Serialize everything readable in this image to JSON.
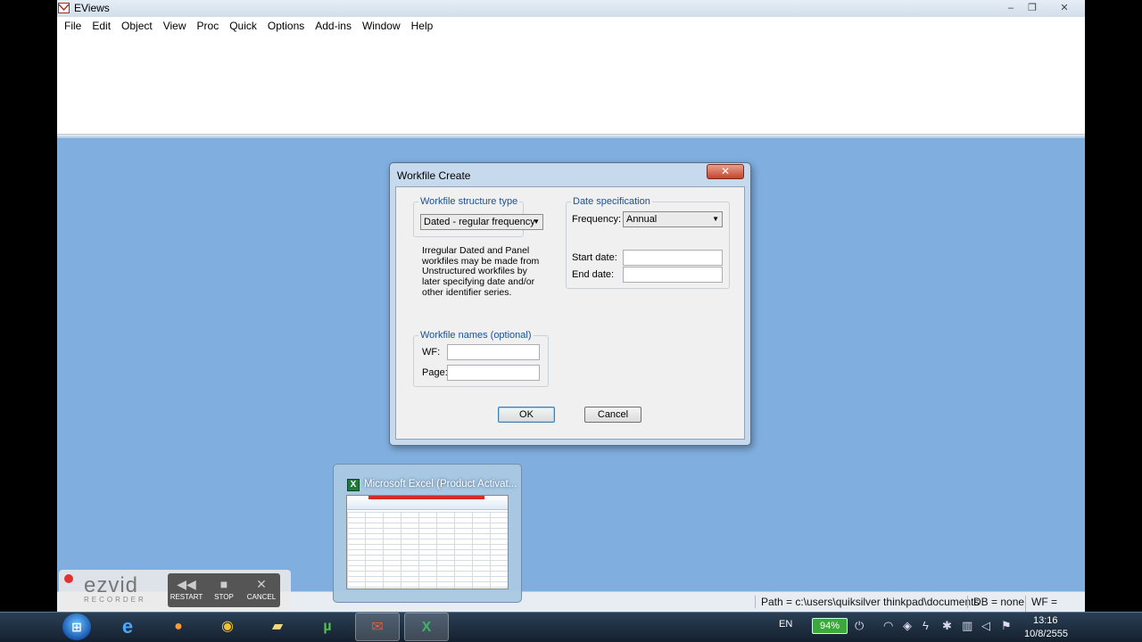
{
  "app": {
    "title": "EViews",
    "menu": [
      "File",
      "Edit",
      "Object",
      "View",
      "Proc",
      "Quick",
      "Options",
      "Add-ins",
      "Window",
      "Help"
    ],
    "status": {
      "path": "Path = c:\\users\\quiksilver thinkpad\\documents",
      "db": "DB = none",
      "wf": "WF = none"
    }
  },
  "dialog": {
    "title": "Workfile Create",
    "close_glyph": "✕",
    "structure": {
      "legend": "Workfile structure type",
      "selected": "Dated - regular frequency",
      "info": "Irregular Dated and Panel workfiles may be made from Unstructured workfiles by later specifying date and/or other identifier series."
    },
    "date_spec": {
      "legend": "Date specification",
      "frequency_label": "Frequency:",
      "frequency_value": "Annual",
      "start_label": "Start date:",
      "start_value": "",
      "end_label": "End date:",
      "end_value": ""
    },
    "names": {
      "legend": "Workfile names (optional)",
      "wf_label": "WF:",
      "wf_value": "",
      "page_label": "Page:",
      "page_value": ""
    },
    "ok_label": "OK",
    "cancel_label": "Cancel"
  },
  "thumbnail": {
    "title": "Microsoft Excel (Product Activat..."
  },
  "ezvid": {
    "logo": "ezvid",
    "sub": "RECORDER",
    "restart": "RESTART",
    "stop": "STOP",
    "cancel": "CANCEL"
  },
  "taskbar": {
    "language": "EN",
    "battery": "94%",
    "time": "13:16",
    "date": "10/8/2555"
  }
}
